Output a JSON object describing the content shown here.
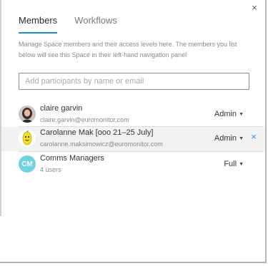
{
  "dialog": {
    "close_glyph": "×"
  },
  "tabs": [
    {
      "label": "Members",
      "active": true
    },
    {
      "label": "Workflows",
      "active": false
    }
  ],
  "description": "Manage Space members and their access levels here. The members you list below will see this Space in their left-hand navigation panel",
  "search": {
    "placeholder": "Add participants by name or email",
    "value": ""
  },
  "members": [
    {
      "name": "claire garvin",
      "sub": "claire.garvin@euromonitor.com",
      "role": "Admin",
      "avatar": "photo-avatar"
    },
    {
      "name": "Carolanne Mak [ooo 21–25 July]",
      "sub": "carolanne.maksimowicz@euromonitor.com",
      "role": "Admin",
      "avatar": "lemon-avatar",
      "remove_glyph": "×"
    },
    {
      "name": "Comms Managers",
      "sub": "4 users",
      "role": "Full",
      "avatar": "initials-avatar",
      "initials": "CM"
    }
  ],
  "colors": {
    "accent": "#1f8bd1",
    "initials_bg": "#6fd3e2",
    "remove": "#3a8fd6"
  },
  "caret_glyph": "▼"
}
